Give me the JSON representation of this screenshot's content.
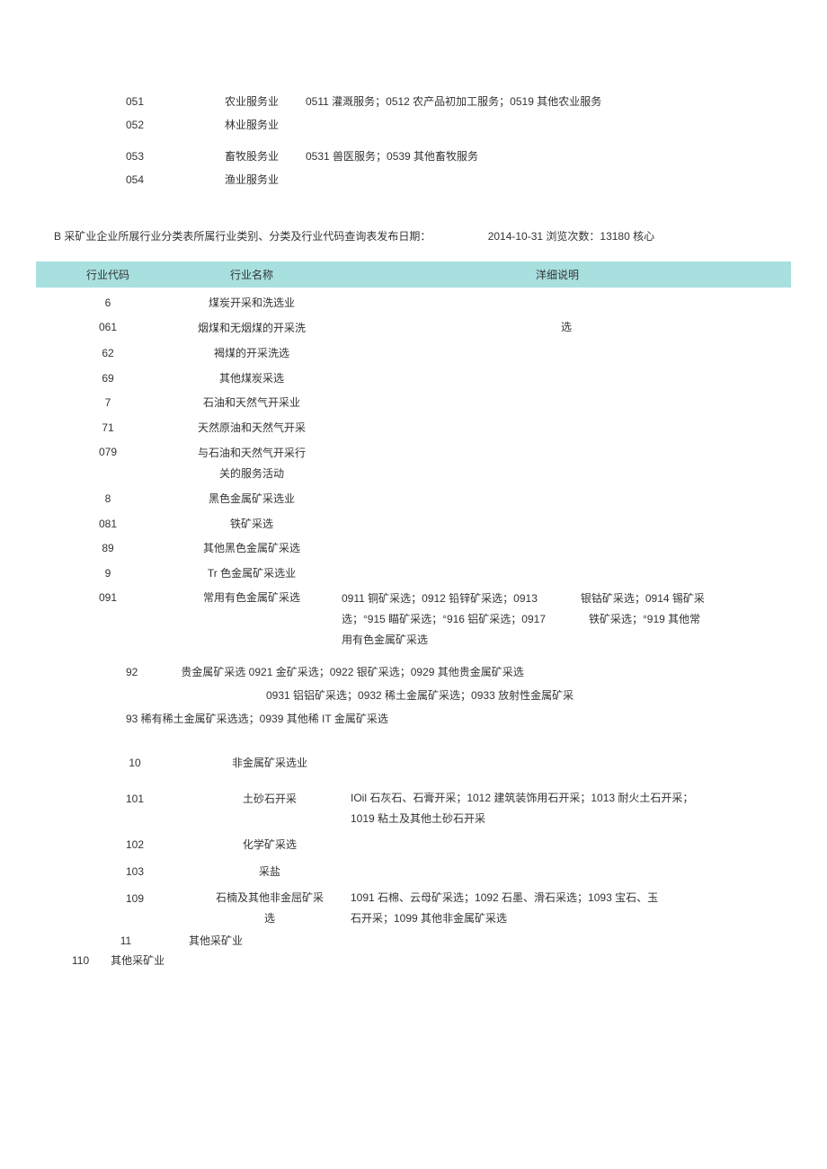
{
  "top_table": {
    "rows": [
      {
        "code": "051",
        "name": "农业服务业",
        "desc": "0511 灌溉服务；0512 农产品初加工服务；0519 其他农业服务"
      },
      {
        "code": "052",
        "name": "林业服务业",
        "desc": ""
      },
      {
        "code": "053",
        "name": "畜牧股务业",
        "desc": "0531 兽医服务；0539 其他畜牧服务"
      },
      {
        "code": "054",
        "name": "渔业服务业",
        "desc": ""
      }
    ]
  },
  "section_title": {
    "text": "B 采矿业企业所展行业分类表所属行业类别、分类及行业代码查询表发布日期：",
    "date": "2014-10-31 浏览次数：13180 核心"
  },
  "table2": {
    "headers": {
      "code": "行业代码",
      "name": "行业名称",
      "desc": "洋细说明"
    },
    "rows": [
      {
        "code": "6",
        "name": "煤炭开采和洗选业",
        "desc": ""
      },
      {
        "code": "061",
        "name": "烟煤和无烟煤的开采洗",
        "desc": "选"
      },
      {
        "code": "62",
        "name": "褐煤的开采洗选",
        "desc": ""
      },
      {
        "code": "69",
        "name": "其他煤炭采选",
        "desc": ""
      },
      {
        "code": "7",
        "name": "石油和天然气开采业",
        "desc": ""
      },
      {
        "code": "71",
        "name": "天然原油和天然气开采",
        "desc": ""
      },
      {
        "code": "079",
        "name": "与石油和天然气开采行\n关的服务活动",
        "desc": ""
      },
      {
        "code": "8",
        "name": "黑色金属矿采选业",
        "desc": ""
      },
      {
        "code": "081",
        "name": "铁矿采选",
        "desc": ""
      },
      {
        "code": "89",
        "name": "其他黑色金属矿采选",
        "desc": ""
      },
      {
        "code": "9",
        "name": "Tr 色金属矿采选业",
        "desc": ""
      },
      {
        "code": "091",
        "name": "常用有色金属矿采选",
        "desc": "0911 铜矿采选；0912 铅锌矿采选；0913　　　　银钴矿采选；0914 锡矿采\n选；°915 瞄矿采选；°916 铝矿采选；0917　　　　铁矿采选；°919 其他常\n用有色金属矿采选"
      }
    ],
    "freeform": [
      "92　　　　贵金属矿采选 0921 金矿采选；0922 银矿采选；0929 其他贵金属矿采选",
      "　　　　　　　　　　　　　0931 铝铝矿采选；0932 稀土金属矿采选；0933 放射性金属矿采",
      "93 稀有稀土金属矿采选选；0939 其他稀 IT 金属矿采选"
    ]
  },
  "bottom_block": {
    "rows": [
      {
        "code": "10",
        "name": "非金属矿采选业",
        "desc": ""
      },
      {
        "code": "101",
        "name": "土砂石开采",
        "desc": "IOil 石灰石、石膏开采；1012 建筑装饰用石开采；1013 耐火土石开采；\n1019 粘土及其他土砂石开采"
      },
      {
        "code": "102",
        "name": "化学矿采选",
        "desc": ""
      },
      {
        "code": "103",
        "name": "采盐",
        "desc": ""
      },
      {
        "code": "109",
        "name": "石楠及其他非金屈矿采\n选",
        "desc": "1091 石棉、云母矿采选；1092 石墨、滑石采选；1093 宝石、玉\n石开采；1099 其他非金属矿采选"
      }
    ],
    "last": {
      "left_line1": "11",
      "left_line2": "110　　其他采矿业",
      "right_line1": "其他采矿业"
    }
  }
}
